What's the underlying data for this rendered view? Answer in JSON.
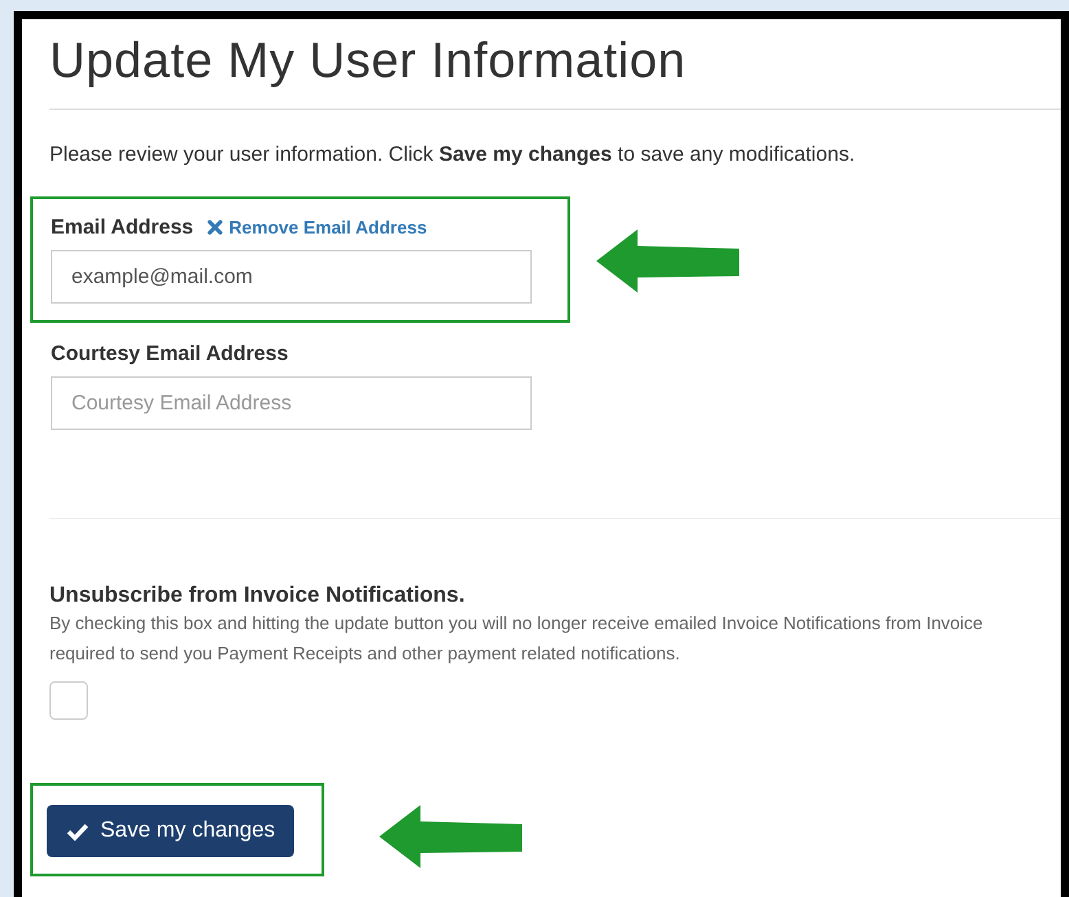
{
  "title": "Update My User Information",
  "intro": "Please review your user information. Click **Save my changes** to save any modifications.",
  "email": {
    "label": "Email Address",
    "remove_link": "Remove Email Address",
    "value": "example@mail.com",
    "highlighted": true
  },
  "courtesy_email": {
    "label": "Courtesy Email Address",
    "placeholder": "Courtesy Email Address"
  },
  "unsubscribe": {
    "label": "Unsubscribe from Invoice Notifications.",
    "description": [
      "By checking this box and hitting the update button you will no longer receive emailed Invoice Notifications from Invoice",
      "required to send you Payment Receipts and other payment related notifications."
    ],
    "checked": false
  },
  "save_button": {
    "label": "Save my changes",
    "highlighted": true
  }
}
